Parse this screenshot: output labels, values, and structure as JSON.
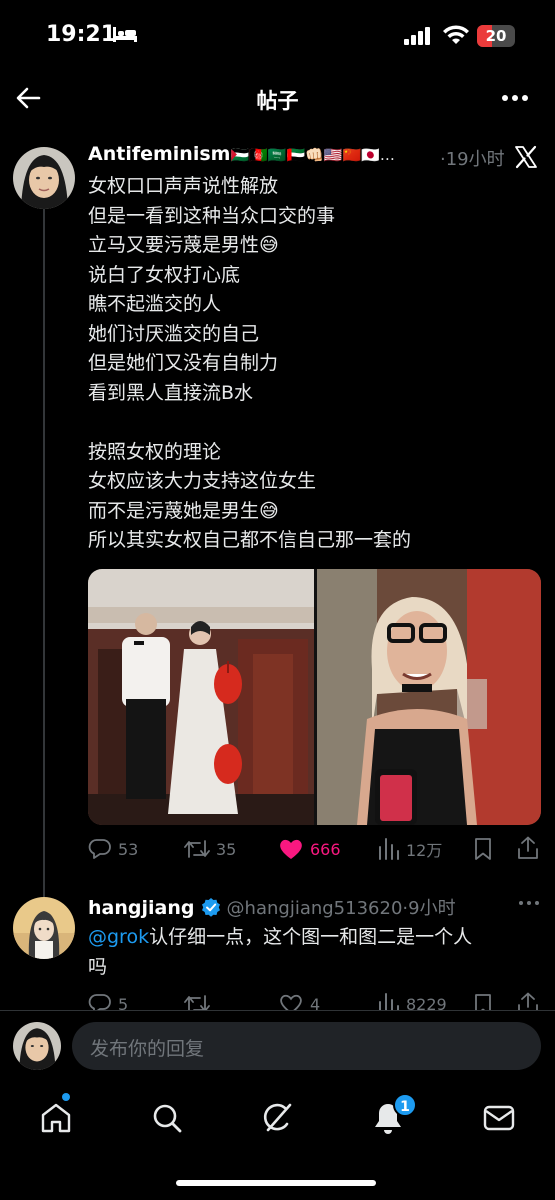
{
  "status_bar": {
    "time": "19:21",
    "battery": "20"
  },
  "nav": {
    "title": "帖子"
  },
  "tweet": {
    "author_name": "Antifeminism",
    "author_flags": "🇵🇸🇦🇫🇸🇦🇦🇪👊🏻🇺🇸🇨🇳🇯🇵…",
    "time": "·19小时",
    "lines": [
      "女权口口声声说性解放",
      "但是一看到这种当众口交的事",
      "立马又要污蔑是男性😅",
      "说白了女权打心底",
      "瞧不起滥交的人",
      "她们讨厌滥交的自己",
      "但是她们又没有自制力",
      "看到黑人直接流B水",
      "",
      "按照女权的理论",
      "女权应该大力支持这位女生",
      "而不是污蔑她是男生😅",
      "所以其实女权自己都不信自己那一套的"
    ],
    "stats": {
      "replies": "53",
      "retweets": "35",
      "likes": "666",
      "views": "12万"
    }
  },
  "reply": {
    "author_name": "hangjiang",
    "handle": "@hangjiang513620·9小时",
    "mention": "@grok",
    "text_line1": "认仔细一点，这个图一和图二是一个人",
    "text_line2": "吗",
    "stats": {
      "replies": "5",
      "likes": "4",
      "views": "8229"
    }
  },
  "composer": {
    "placeholder": "发布你的回复"
  },
  "tabs": [
    "home-icon",
    "search-icon",
    "grok-icon",
    "notifications-icon",
    "messages-icon"
  ],
  "notifications_badge": "1",
  "colors": {
    "accent": "#1d9bf0",
    "like": "#f91880",
    "muted": "#71767b",
    "background": "#000000"
  }
}
